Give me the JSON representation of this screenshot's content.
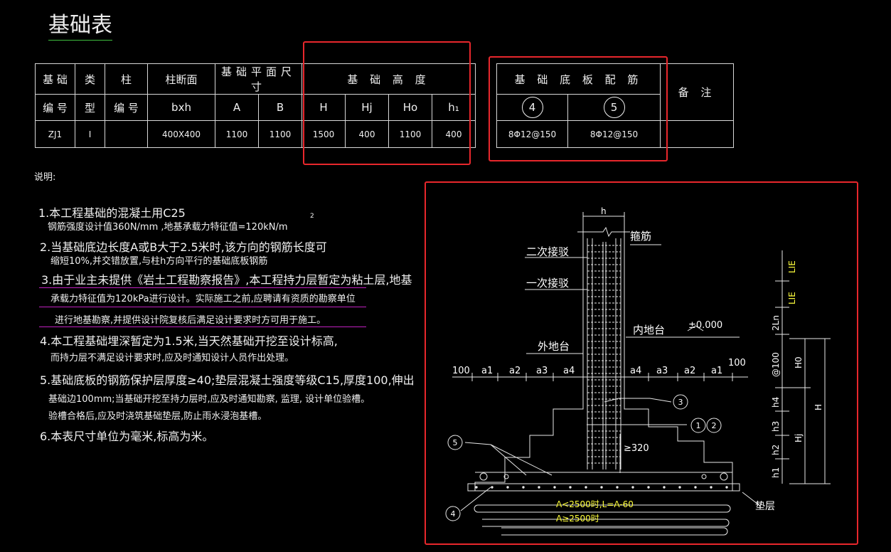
{
  "title": "基础表",
  "table": {
    "h_jcbh1": "基 础",
    "h_jcbh2": "编 号",
    "h_lx1": "类",
    "h_lx2": "型",
    "h_zhu1": "柱",
    "h_zhu2": "编 号",
    "h_zdm": "柱断面",
    "h_bxh": "bxh",
    "h_pmcc": "基础平面尺寸",
    "h_A": "A",
    "h_B": "B",
    "h_jcgd": "基 础 高 度",
    "h_H": "H",
    "h_Hj": "Hj",
    "h_Ho": "Ho",
    "h_h1": "h₁",
    "h_pj": "基 础 底 板 配 筋",
    "h_c4": "4",
    "h_c5": "5",
    "h_bz": "备 注",
    "row": {
      "no": "ZJ1",
      "type": "I",
      "col": "",
      "bxh": "400X400",
      "A": "1100",
      "B": "1100",
      "H": "1500",
      "Hj": "400",
      "Ho": "1100",
      "h1": "400",
      "r4": "8Φ12@150",
      "r5": "8Φ12@150",
      "remark": ""
    }
  },
  "notes": {
    "head": "说明:",
    "n1a": "1.本工程基础的混凝土用C25",
    "n1b": "钢筋强度设计值360N/mm  ,地基承载力特征值=120kN/m",
    "sup2": "2",
    "n2a": "2.当基础底边长度A或B大于2.5米时,该方向的钢筋长度可",
    "n2b": "缩短10%,并交错放置,与柱h方向平行的基础底板钢筋",
    "n3a": "3.由于业主未提供《岩土工程勘察报告》,本工程持力层暂定为粘土层,地基",
    "n3b": "承载力特征值为120kPa进行设计。实际施工之前,应聘请有资质的勘察单位",
    "n3c": "进行地基勘察,并提供设计院复核后满足设计要求时方可用于施工。",
    "n4a": "4.本工程基础埋深暂定为1.5米,当天然基础开挖至设计标高,",
    "n4b": "而持力层不满足设计要求时,应及时通知设计人员作出处理。",
    "n5a": "5.基础底板的钢筋保护层厚度≥40;垫层混凝土强度等级C15,厚度100,伸出",
    "n5b": "基础边100mm;当基础开挖至持力层时,应及时通知勘察, 监理, 设计单位验槽。",
    "n5c": "验槽合格后,应及时浇筑基础垫层,防止雨水浸泡基槽。",
    "n6": "6.本表尺寸单位为毫米,标高为米。"
  },
  "drawing": {
    "h": "h",
    "gujin": "箍筋",
    "erci": "二次接驳",
    "yici": "一次接驳",
    "neidt": "内地台",
    "waidt": "外地台",
    "elev": "±0.000",
    "d100": "100",
    "a1": "a1",
    "a2": "a2",
    "a3": "a3",
    "a4": "a4",
    "c3": "3",
    "c1": "1",
    "c2": "2",
    "c4": "4",
    "c5": "5",
    "ge320": "≥320",
    "note1": "A<2500时,L=A-60",
    "note2": "A≥2500时",
    "dianceng": "垫层",
    "dim_LIE1": "LIE",
    "dim_LIE2": "LIE",
    "dim_2Ln": "2Ln",
    "dim_at100": "@100",
    "dim_h4": "h4",
    "dim_h3": "h3",
    "dim_h2": "h2",
    "dim_h1": "h1",
    "dim_H0": "H0",
    "dim_H": "H",
    "dim_Hj": "Hj"
  },
  "colors": {
    "highlight": "#e8272c",
    "yellow": "#ffff3c",
    "magenta": "#c020c0",
    "green": "#3fbf3f"
  }
}
